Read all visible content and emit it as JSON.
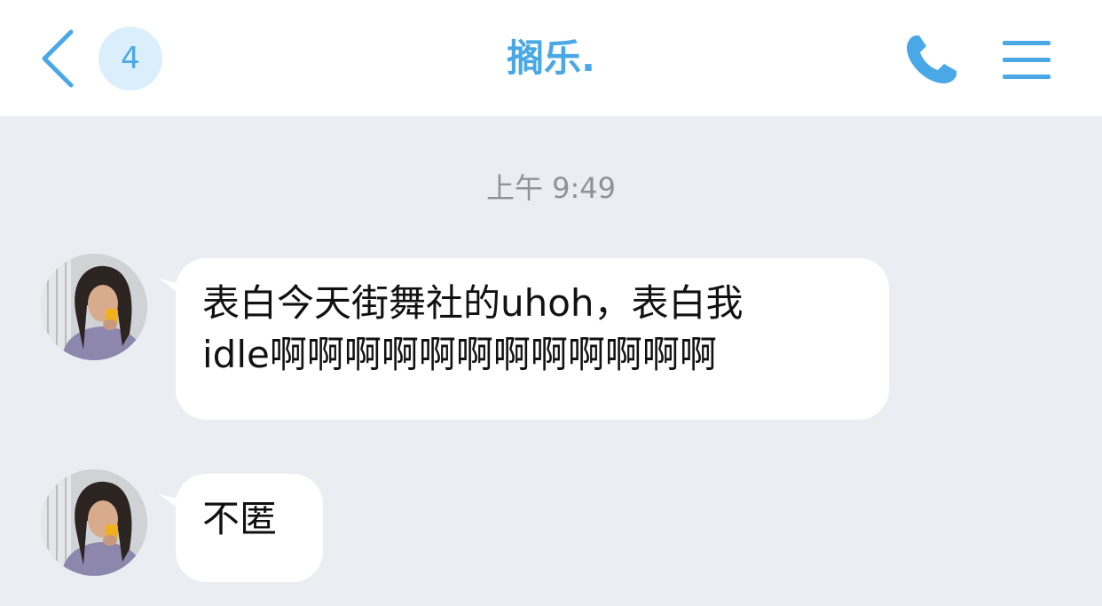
{
  "header": {
    "unread_count": "4",
    "title": "搁乐.",
    "icons": [
      "chevron-left-icon",
      "phone-icon",
      "menu-icon"
    ],
    "accent_color": "#4aa8e6"
  },
  "chat": {
    "timestamp": "上午 9:49",
    "messages": [
      {
        "sender": "other",
        "text": "表白今天街舞社的uhoh，表白我\nidle啊啊啊啊啊啊啊啊啊啊啊啊"
      },
      {
        "sender": "other",
        "text": "不匿"
      }
    ]
  }
}
